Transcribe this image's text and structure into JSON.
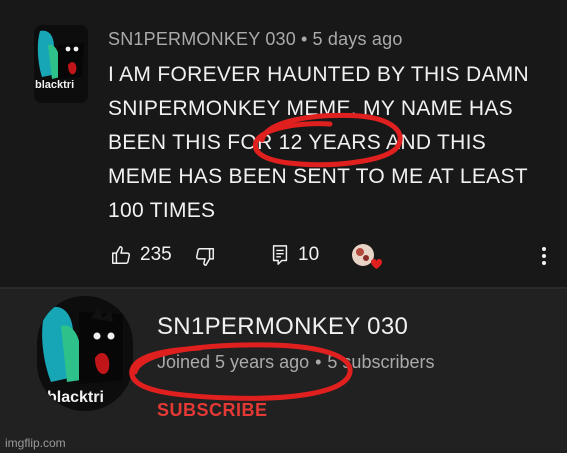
{
  "comment": {
    "author": "SN1PERMONKEY 030",
    "separator": "•",
    "time": "5 days ago",
    "avatar_text": "blacktri",
    "lines": [
      "I AM FOREVER HAUNTED BY THIS DAMN",
      "SNIPERMONKEY MEME. MY NAME HAS",
      "BEEN THIS FOR 12 YEARS AND THIS",
      "MEME HAS BEEN SENT TO ME AT LEAST",
      "100 TIMES"
    ],
    "likes": "235",
    "replies": "10",
    "icons": [
      "thumbs-up-icon",
      "thumbs-down-icon",
      "reply-icon",
      "creator-heart-icon",
      "more-vert-icon"
    ]
  },
  "channel": {
    "name": "SN1PERMONKEY 030",
    "joined": "Joined 5 years ago",
    "separator": "•",
    "subscribers": "5 subscribers",
    "subscribe_label": "SUBSCRIBE",
    "avatar_text": "blacktri"
  },
  "watermark": "imgflip.com",
  "colors": {
    "top_background": "#181818",
    "bottom_background": "#212121",
    "text_primary": "#f1f1f1",
    "text_secondary": "#aaaaaa",
    "subscribe": "#e53935",
    "annotation_red": "#e0201f"
  }
}
